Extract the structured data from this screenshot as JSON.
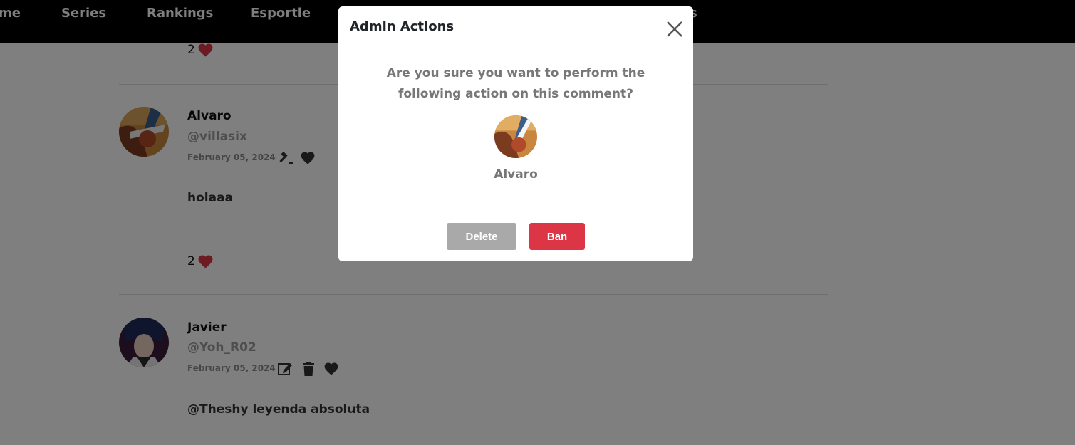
{
  "nav": {
    "items": [
      "me",
      "Series",
      "Rankings",
      "Esportle"
    ],
    "partial_right": "s"
  },
  "comments": [
    {
      "likes": "2"
    },
    {
      "name": "Alvaro",
      "handle": "@villasix",
      "date": "February 05, 2024",
      "text": "holaaa",
      "likes": "2",
      "actions": [
        "gavel-icon",
        "heart-icon"
      ]
    },
    {
      "name": "Javier",
      "handle": "@Yoh_R02",
      "date": "February 05, 2024",
      "text": "@Theshy leyenda absoluta",
      "actions": [
        "edit-icon",
        "trash-icon",
        "heart-icon"
      ]
    }
  ],
  "modal": {
    "title": "Admin Actions",
    "question": "Are you sure you want to perform the following action on this comment?",
    "user_name": "Alvaro",
    "delete_label": "Delete",
    "ban_label": "Ban"
  },
  "colors": {
    "navbar": "#000000",
    "heart": "#dc3545",
    "ban_button": "#dc3545",
    "delete_button": "#a9a9a9",
    "overlay": "rgba(0,0,0,0.5)"
  }
}
